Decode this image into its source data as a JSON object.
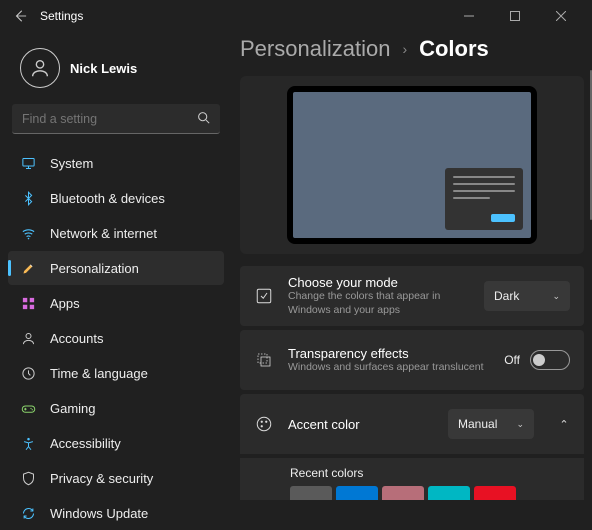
{
  "window": {
    "title": "Settings"
  },
  "user": {
    "name": "Nick Lewis"
  },
  "search": {
    "placeholder": "Find a setting"
  },
  "sidebar": {
    "items": [
      {
        "label": "System",
        "icon": "system-icon",
        "color": "#4cc2ff"
      },
      {
        "label": "Bluetooth & devices",
        "icon": "bluetooth-icon",
        "color": "#4cc2ff"
      },
      {
        "label": "Network & internet",
        "icon": "wifi-icon",
        "color": "#4cc2ff"
      },
      {
        "label": "Personalization",
        "icon": "personalization-icon",
        "color": "#f7b955",
        "selected": true
      },
      {
        "label": "Apps",
        "icon": "apps-icon",
        "color": "#d86adf"
      },
      {
        "label": "Accounts",
        "icon": "accounts-icon",
        "color": "#ccc"
      },
      {
        "label": "Time & language",
        "icon": "time-language-icon",
        "color": "#ccc"
      },
      {
        "label": "Gaming",
        "icon": "gaming-icon",
        "color": "#8bd46c"
      },
      {
        "label": "Accessibility",
        "icon": "accessibility-icon",
        "color": "#4cc2ff"
      },
      {
        "label": "Privacy & security",
        "icon": "privacy-icon",
        "color": "#ccc"
      },
      {
        "label": "Windows Update",
        "icon": "update-icon",
        "color": "#4cc2ff"
      }
    ]
  },
  "header": {
    "parent": "Personalization",
    "current": "Colors"
  },
  "mode": {
    "title": "Choose your mode",
    "sub": "Change the colors that appear in Windows and your apps",
    "value": "Dark"
  },
  "transparency": {
    "title": "Transparency effects",
    "sub": "Windows and surfaces appear translucent",
    "state": "Off"
  },
  "accent": {
    "title": "Accent color",
    "value": "Manual",
    "recent_label": "Recent colors",
    "recent": [
      "#5a5a5a",
      "#0078d4",
      "#b76e79",
      "#00b7c3",
      "#e81123"
    ]
  }
}
